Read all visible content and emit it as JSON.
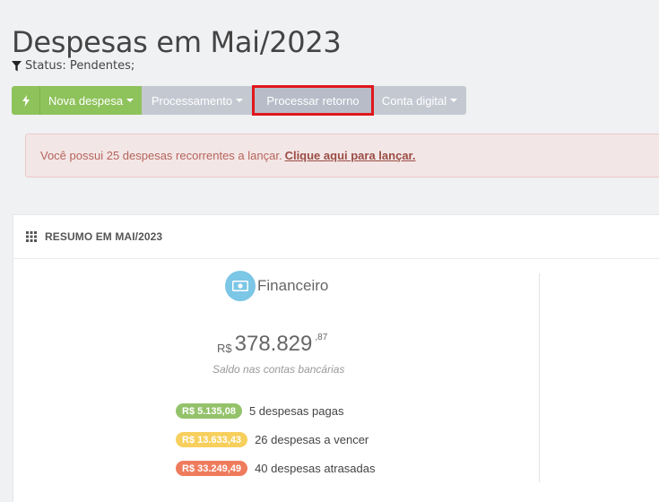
{
  "page": {
    "title": "Despesas em Mai/2023",
    "status": "Status: Pendentes;"
  },
  "toolbar": {
    "nova_despesa": "Nova despesa",
    "processamento": "Processamento",
    "processar_retorno": "Processar retorno",
    "conta_digital": "Conta digital"
  },
  "alert": {
    "text": "Você possui 25 despesas recorrentes a lançar.",
    "link": "Clique aqui para lançar."
  },
  "summary": {
    "title": "RESUMO EM MAI/2023",
    "financeiro": {
      "label": "Financeiro",
      "currency": "R$",
      "amount": "378.829",
      "cents": ",87",
      "caption": "Saldo nas contas bancárias",
      "rows": [
        {
          "badge": "R$ 5.135,08",
          "text": "5 despesas pagas",
          "color": "#93c26a"
        },
        {
          "badge": "R$ 13.633,43",
          "text": "26 despesas a vencer",
          "color": "#f7cf5c"
        },
        {
          "badge": "R$ 33.249,49",
          "text": "40 despesas atrasadas",
          "color": "#ef7b5d"
        }
      ]
    }
  },
  "colors": {
    "primary": "#8ec25b",
    "secondary": "#c4c8d1",
    "highlight": "#e0171c",
    "info": "#7cc6e6"
  }
}
